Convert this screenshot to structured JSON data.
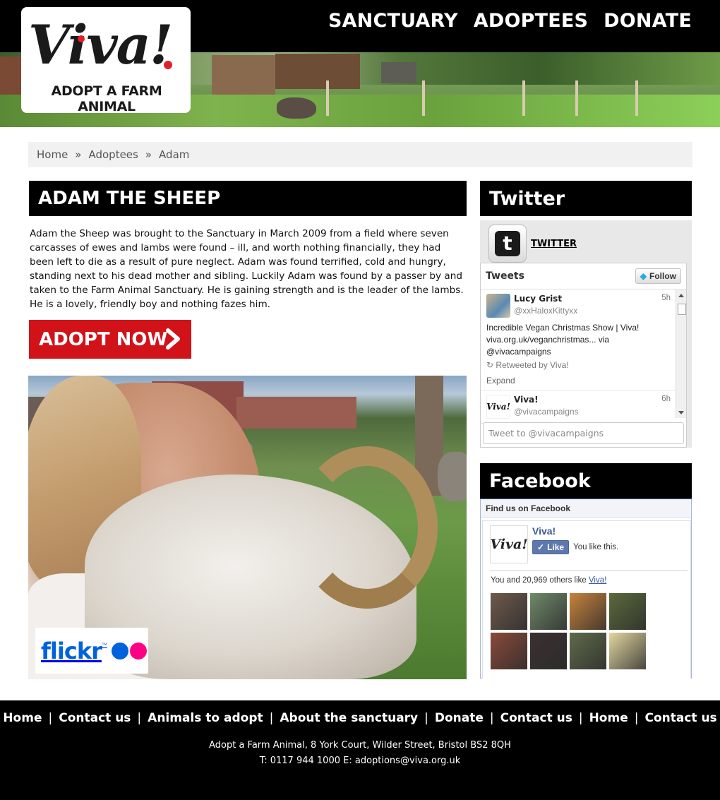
{
  "header": {
    "logo_wordmark": "Viva!",
    "logo_tagline": "ADOPT A FARM ANIMAL",
    "nav": [
      "SANCTUARY",
      "ADOPTEES",
      "DONATE"
    ]
  },
  "breadcrumb": {
    "items": [
      "Home",
      "Adoptees",
      "Adam"
    ],
    "separator": "»"
  },
  "main": {
    "title": "ADAM THE SHEEP",
    "story": "Adam the Sheep was brought to the Sanctuary in March 2009 from a field where seven carcasses of ewes and lambs were found – ill, and worth nothing financially, they had been left  to die as a result of pure neglect. Adam was found terrified, cold and hungry, standing next to his dead mother and sibling. Luckily Adam was found by a passer by and taken to the Farm Animal Sanctuary. He is gaining strength and is the leader of the lambs. He is a lovely, friendly boy and nothing fazes him.",
    "adopt_button": "ADOPT NOW",
    "photo_badge": {
      "wordmark": "flickr",
      "tm": "™",
      "icon": "flickr-logo"
    }
  },
  "sidebar": {
    "twitter": {
      "heading": "Twitter",
      "profile_link": "TWITTER",
      "timeline_title": "Tweets",
      "follow_label": "Follow",
      "tweets": [
        {
          "name": "Lucy Grist",
          "handle": "@xxHaloxKittyxx",
          "time": "5h",
          "text": "Incredible Vegan Christmas Show | Viva! viva.org.uk/veganchristmas... via @vivacampaigns",
          "retweet": "Retweeted by Viva!",
          "expand": "Expand"
        },
        {
          "name": "Viva!",
          "handle": "@vivacampaigns",
          "time": "6h"
        }
      ],
      "compose_placeholder": "Tweet to @vivacampaigns"
    },
    "facebook": {
      "heading": "Facebook",
      "widget_title": "Find us on Facebook",
      "page_name": "Viva!",
      "like_label": "Like",
      "like_status": "You like this.",
      "count_text": "You and 20,969 others like",
      "count_page": "Viva!",
      "face_colors": [
        "#6e5a4d",
        "#6f8a6a",
        "#c8823c",
        "#5a6a3c",
        "#8a4a3a",
        "#3b3030",
        "#5f6b4a",
        "#e2d6a0"
      ]
    }
  },
  "footer": {
    "links": [
      "Home",
      "Contact us",
      "Animals to adopt",
      "About the sanctuary",
      "Donate",
      "Contact us",
      "Home",
      "Contact us"
    ],
    "address": "Adopt a Farm Animal, 8 York Court, Wilder Street, Bristol BS2 8QH",
    "contact": "T: 0117 944 1000 E: adoptions@viva.org.uk"
  },
  "colors": {
    "brand_red": "#d21219",
    "black": "#000000",
    "twitter_blue": "#2aa9e0",
    "facebook_blue": "#3b5998",
    "flickr_blue": "#0063dc",
    "flickr_pink": "#ff0084"
  }
}
